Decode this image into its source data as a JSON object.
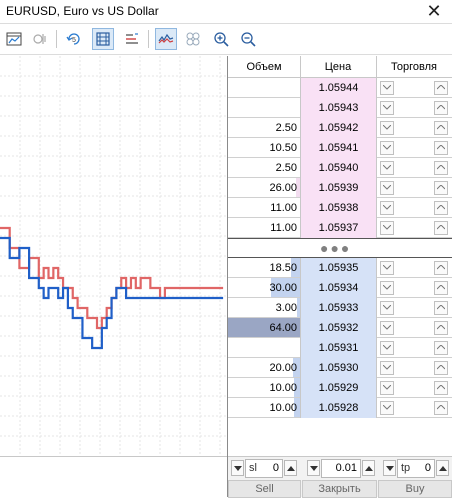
{
  "window": {
    "title": "EURUSD, Euro vs US Dollar",
    "close_glyph": "✕"
  },
  "toolbar": {
    "buttons": [
      {
        "icon": "chart-window-icon",
        "active": false
      },
      {
        "icon": "depth-settings-icon",
        "active": false
      },
      {
        "icon": "tick-chart-icon",
        "active": false
      },
      {
        "icon": "one-click-trading-icon",
        "active": true
      },
      {
        "icon": "dom-levels-icon",
        "active": false
      },
      {
        "icon": "line-chart-icon",
        "active": true
      },
      {
        "icon": "circles-icon",
        "active": false
      },
      {
        "icon": "zoom-in-icon",
        "active": false
      },
      {
        "icon": "zoom-out-icon",
        "active": false
      }
    ]
  },
  "dom": {
    "headers": {
      "volume": "Объем",
      "price": "Цена",
      "trade": "Торговля"
    },
    "asks": [
      {
        "volume": "",
        "price": "1.05944",
        "volume_fraction": 0
      },
      {
        "volume": "",
        "price": "1.05943",
        "volume_fraction": 0
      },
      {
        "volume": "2.50",
        "price": "1.05942",
        "volume_fraction": 0
      },
      {
        "volume": "10.50",
        "price": "1.05941",
        "volume_fraction": 0
      },
      {
        "volume": "2.50",
        "price": "1.05940",
        "volume_fraction": 0
      },
      {
        "volume": "26.00",
        "price": "1.05939",
        "volume_fraction": 0.06
      },
      {
        "volume": "11.00",
        "price": "1.05938",
        "volume_fraction": 0
      },
      {
        "volume": "11.00",
        "price": "1.05937",
        "volume_fraction": 0
      }
    ],
    "spread_indicator": "●●●",
    "bids": [
      {
        "volume": "18.50",
        "price": "1.05935",
        "volume_fraction": 0.12
      },
      {
        "volume": "30.00",
        "price": "1.05934",
        "volume_fraction": 0.4
      },
      {
        "volume": "3.00",
        "price": "1.05933",
        "volume_fraction": 0.04
      },
      {
        "volume": "64.00",
        "price": "1.05932",
        "volume_fraction": 1.0
      },
      {
        "volume": "",
        "price": "1.05931",
        "volume_fraction": 0
      },
      {
        "volume": "20.00",
        "price": "1.05930",
        "volume_fraction": 0.1
      },
      {
        "volume": "10.00",
        "price": "1.05929",
        "volume_fraction": 0.08
      },
      {
        "volume": "10.00",
        "price": "1.05928",
        "volume_fraction": 0.08
      }
    ],
    "colors": {
      "ask_price_bg": "#f9e1f5",
      "bid_price_bg": "#d6e2f7",
      "ask_volume_bar": "#f2dcef",
      "bid_volume_bar": "#c3d3ef",
      "bid_volume_bar_dark": "#9aa6c4"
    }
  },
  "order": {
    "sl_label": "sl",
    "sl_value": "0",
    "lot_value": "0.01",
    "tp_label": "tp",
    "tp_value": "0",
    "sell_label": "Sell",
    "close_label": "Закрыть",
    "buy_label": "Buy"
  },
  "chart_data": {
    "type": "line",
    "series": [
      {
        "color": "#e06666",
        "values": [
          10,
          10,
          8,
          8,
          6,
          6,
          7,
          7,
          5,
          6,
          5,
          6,
          5,
          4,
          4,
          3,
          2,
          2,
          1,
          1,
          0,
          1,
          2,
          3,
          4,
          5,
          4,
          5,
          4,
          5,
          5,
          4,
          4,
          3,
          4,
          4,
          4,
          4,
          4,
          4,
          4,
          4,
          4,
          4,
          4,
          4,
          4
        ]
      },
      {
        "color": "#1f5fc8",
        "values": [
          9,
          9,
          7,
          7,
          8,
          8,
          5,
          5,
          4,
          3,
          4,
          4,
          3,
          4,
          2,
          1,
          1,
          -1,
          -1,
          -2,
          -2,
          0,
          1,
          3,
          4,
          4,
          3,
          3,
          3,
          3,
          3,
          3,
          3,
          3,
          3,
          3,
          3,
          3,
          3,
          3,
          3,
          3,
          3,
          3,
          3,
          3,
          3
        ]
      }
    ],
    "grid": true
  }
}
